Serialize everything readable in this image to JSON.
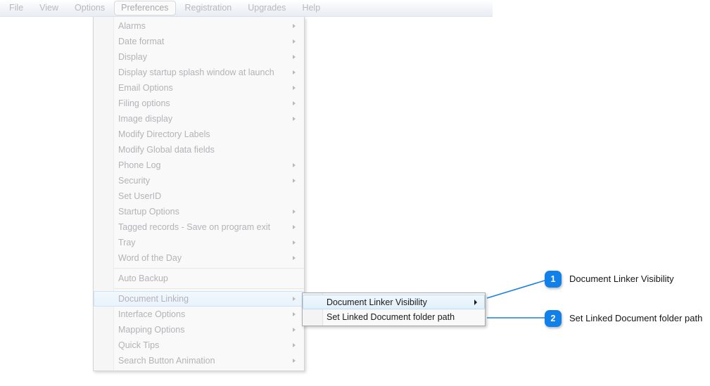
{
  "menubar": {
    "items": [
      {
        "label": "File",
        "active": false
      },
      {
        "label": "View",
        "active": false
      },
      {
        "label": "Options",
        "active": false
      },
      {
        "label": "Preferences",
        "active": true
      },
      {
        "label": "Registration",
        "active": false
      },
      {
        "label": "Upgrades",
        "active": false
      },
      {
        "label": "Help",
        "active": false
      }
    ]
  },
  "main_menu": {
    "items": [
      {
        "label": "Alarms",
        "submenu": true,
        "selected": false
      },
      {
        "label": "Date format",
        "submenu": true,
        "selected": false
      },
      {
        "label": "Display",
        "submenu": true,
        "selected": false
      },
      {
        "label": "Display startup splash window at launch",
        "submenu": true,
        "selected": false
      },
      {
        "label": "Email Options",
        "submenu": true,
        "selected": false
      },
      {
        "label": "Filing options",
        "submenu": true,
        "selected": false
      },
      {
        "label": "Image display",
        "submenu": true,
        "selected": false
      },
      {
        "label": "Modify Directory Labels",
        "submenu": false,
        "selected": false
      },
      {
        "label": "Modify Global data fields",
        "submenu": false,
        "selected": false
      },
      {
        "label": "Phone Log",
        "submenu": true,
        "selected": false
      },
      {
        "label": "Security",
        "submenu": true,
        "selected": false
      },
      {
        "label": "Set UserID",
        "submenu": false,
        "selected": false
      },
      {
        "label": "Startup Options",
        "submenu": true,
        "selected": false
      },
      {
        "label": "Tagged records - Save on program exit",
        "submenu": true,
        "selected": false
      },
      {
        "label": "Tray",
        "submenu": true,
        "selected": false
      },
      {
        "label": "Word of the Day",
        "submenu": true,
        "selected": false
      },
      {
        "separator": true
      },
      {
        "label": "Auto Backup",
        "submenu": false,
        "selected": false
      },
      {
        "separator": true
      },
      {
        "label": "Document Linking",
        "submenu": true,
        "selected": true
      },
      {
        "label": "Interface Options",
        "submenu": true,
        "selected": false
      },
      {
        "label": "Mapping Options",
        "submenu": true,
        "selected": false
      },
      {
        "label": "Quick Tips",
        "submenu": true,
        "selected": false
      },
      {
        "label": "Search Button Animation",
        "submenu": true,
        "selected": false
      }
    ]
  },
  "sub_menu": {
    "items": [
      {
        "label": "Document Linker Visibility",
        "submenu": true,
        "selected": true
      },
      {
        "label": "Set Linked Document folder path",
        "submenu": false,
        "selected": false
      }
    ]
  },
  "callouts": [
    {
      "number": "1",
      "text": "Document Linker Visibility"
    },
    {
      "number": "2",
      "text": "Set Linked Document folder path"
    }
  ],
  "colors": {
    "badge": "#1180e8",
    "connector": "#1b81e0",
    "menu_text": "#b3b3b8",
    "submenu_text": "#1b1b1b"
  }
}
